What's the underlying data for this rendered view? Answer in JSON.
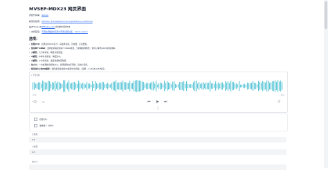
{
  "header": {
    "title": "MVSEP-MDX23 网页界面",
    "original_label": "原始代码库：",
    "original_link": "Github",
    "author_label": "模型创建者：",
    "author_links": "ZFTurbo, FlowerDemon & AnjokDaUnus-I-Witches",
    "webui_prefix": "由ZFTurbo@",
    "webui_link": "ZFTurbo.com",
    "webui_suffix": " 创建的分离方法",
    "note_label": "支持链接：",
    "note_link": "开源在网络的音源分离测试和社区 · demo.sesion"
  },
  "options": {
    "heading": "选项：",
    "items": [
      {
        "name": "仅限CPU：",
        "desc": "如果没有GPU/显卡，请选择此项。比较慢，它就要慢。"
      },
      {
        "name": "使用单个ONNX：",
        "desc": "选择此项将使用单个ONNX模型，分析精度稍微低，但可以降低GPU内存使用率。"
      },
      {
        "name": "大模型：",
        "desc": "大分段重复，精度高但更慢。"
      },
      {
        "name": "中模型：",
        "desc": "中等分段重复，精度适中。"
      },
      {
        "name": "小模型：",
        "desc": "小分段重复，速度快但精度较低。"
      },
      {
        "name": "块大小：",
        "desc": "一次处理的音频块大小。如果遇到内存问题，请减小该值。"
      },
      {
        "name": "使用块大小的VR模型：",
        "desc": "选择此项将使用VR模型分离音频，(需要 ~11.6GB GPU内存)。"
      }
    ]
  },
  "audio": {
    "label": "上传音频",
    "time_start": "0:00",
    "time_end": "6:24",
    "rate": "1x",
    "volume_icon": "volume-icon",
    "waveform_color": "#5fc7d8"
  },
  "checkboxes": [
    {
      "label": "仅限CPU",
      "checked": false
    },
    {
      "label": "使用单个 ONNX",
      "checked": false
    }
  ],
  "fields": [
    {
      "label": "大模型",
      "value": "0.5"
    },
    {
      "label": "小模型",
      "value": "0.5"
    },
    {
      "label": "块大小",
      "value": ""
    }
  ]
}
